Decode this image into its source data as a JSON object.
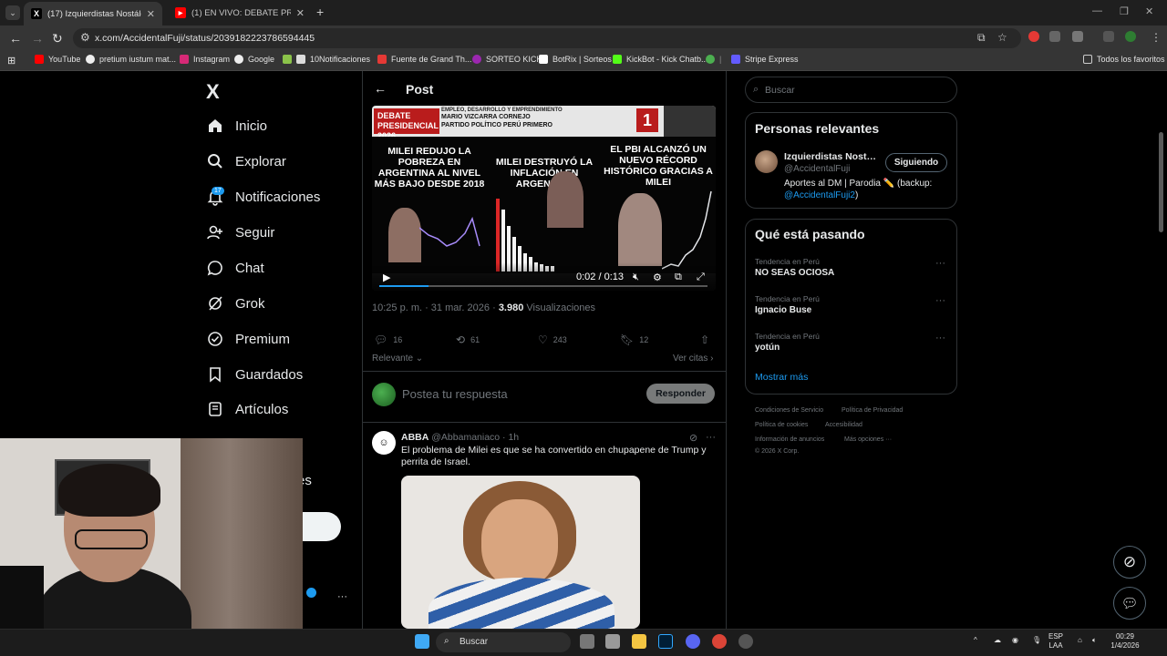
{
  "browser": {
    "tabs": [
      {
        "title": "(17) Izquierdistas Nostálgicos D",
        "active": true
      },
      {
        "title": "(1) EN VIVO: DEBATE PRESIDEN",
        "active": false
      }
    ],
    "url": "x.com/AccidentalFuji/status/2039182223786594445",
    "bookmarks": [
      "YouTube",
      "pretium iustum mat...",
      "Instagram",
      "Google",
      "10Notificaciones",
      "Fuente de Grand Th...",
      "SORTEO KICK",
      "BotRix | Sorteos",
      "KickBot - Kick Chatb...",
      "Stripe Express"
    ],
    "all_bookmarks": "Todos los favoritos",
    "accent": "#1d9bf0"
  },
  "nav": {
    "logo": "X",
    "badge": "17",
    "items": [
      {
        "label": "Inicio",
        "icon": "home-icon"
      },
      {
        "label": "Explorar",
        "icon": "search-icon"
      },
      {
        "label": "Notificaciones",
        "icon": "bell-icon"
      },
      {
        "label": "Seguir",
        "icon": "follow-icon"
      },
      {
        "label": "Chat",
        "icon": "chat-icon"
      },
      {
        "label": "Grok",
        "icon": "grok-icon"
      },
      {
        "label": "Premium",
        "icon": "premium-icon"
      },
      {
        "label": "Guardados",
        "icon": "bookmark-icon"
      },
      {
        "label": "Artículos",
        "icon": "articles-icon"
      }
    ],
    "partial_label": "es"
  },
  "post": {
    "title": "Post",
    "video": {
      "header_badge": "DEBATE PRESIDENCIAL 2026",
      "header_line1": "EMPLEO, DESARROLLO Y EMPRENDIMIENTO",
      "header_line2": "MARIO VIZCARRA CORNEJO",
      "header_line3": "PARTIDO POLÍTICO PERÚ PRIMERO",
      "header_number": "1",
      "panel1": "MILEI REDUJO LA POBREZA EN ARGENTINA AL NIVEL MÁS BAJO DESDE 2018",
      "panel2": "MILEI DESTRUYÓ LA INFLACIÓN EN ARGENTINA",
      "panel3": "EL PBI ALCANZÓ UN NUEVO RÉCORD HISTÓRICO GRACIAS A MILEI",
      "time": "0:02 / 0:13",
      "progress": 0.15
    },
    "time": "10:25 p. m. · 31 mar. 2026 ·",
    "views": "3.980",
    "views_label": "Visualizaciones",
    "replies": "16",
    "reposts": "61",
    "likes": "243",
    "bookmarks": "12",
    "sort_label": "Relevante",
    "quotes_label": "Ver citas",
    "reply_placeholder": "Postea tu respuesta",
    "reply_button": "Responder"
  },
  "reply": {
    "name": "ABBA",
    "handle": "@Abbamaniaco · 1h",
    "text": "El problema de Milei es que se ha convertido en chupapene de Trump y perrita de Israel."
  },
  "right": {
    "search_placeholder": "Buscar",
    "relevant_title": "Personas relevantes",
    "person_name": "Izquierdistas Nostá...",
    "person_handle": "@AccidentalFuji",
    "follow_label": "Siguiendo",
    "bio_text": "Aportes al DM | Parodia ✏️ (backup:",
    "bio_link": "@AccidentalFuji2",
    "bio_end": ")",
    "trends_title": "Qué está pasando",
    "trends": [
      {
        "context": "Tendencia en Perú",
        "name": "NO SEAS OCIOSA"
      },
      {
        "context": "Tendencia en Perú",
        "name": "Ignacio Buse"
      },
      {
        "context": "Tendencia en Perú",
        "name": "yotún"
      }
    ],
    "show_more": "Mostrar más",
    "footer": [
      "Condiciones de Servicio",
      "Política de Privacidad",
      "Política de cookies",
      "Accesibilidad",
      "Información de anuncios",
      "Más opciones ···",
      "© 2026 X Corp."
    ]
  },
  "taskbar": {
    "search": "Buscar",
    "lang": "ESP",
    "lang2": "LAA",
    "time": "00:29",
    "date": "1/4/2026"
  }
}
